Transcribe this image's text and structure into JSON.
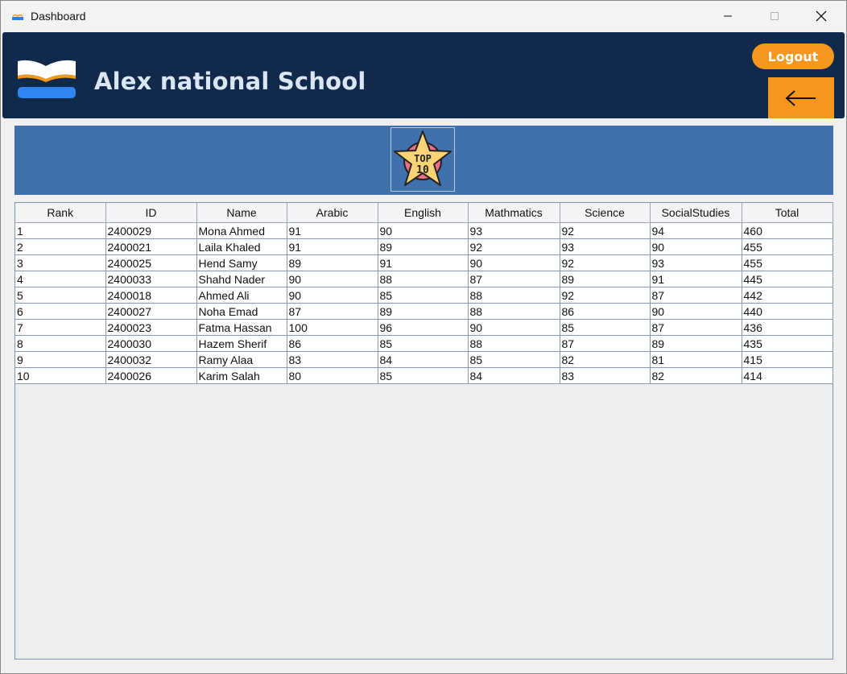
{
  "window": {
    "title": "Dashboard"
  },
  "header": {
    "school_name": "Alex national School",
    "logout_label": "Logout"
  },
  "banner": {
    "badge_line1": "TOP",
    "badge_line2": "10"
  },
  "table": {
    "columns": [
      "Rank",
      "ID",
      "Name",
      "Arabic",
      "English",
      "Mathmatics",
      "Science",
      "SocialStudies",
      "Total"
    ],
    "rows": [
      [
        "1",
        "2400029",
        "Mona Ahmed",
        "91",
        "90",
        "93",
        "92",
        "94",
        "460"
      ],
      [
        "2",
        "2400021",
        "Laila Khaled",
        "91",
        "89",
        "92",
        "93",
        "90",
        "455"
      ],
      [
        "3",
        "2400025",
        "Hend Samy",
        "89",
        "91",
        "90",
        "92",
        "93",
        "455"
      ],
      [
        "4",
        "2400033",
        "Shahd Nader",
        "90",
        "88",
        "87",
        "89",
        "91",
        "445"
      ],
      [
        "5",
        "2400018",
        "Ahmed Ali",
        "90",
        "85",
        "88",
        "92",
        "87",
        "442"
      ],
      [
        "6",
        "2400027",
        "Noha Emad",
        "87",
        "89",
        "88",
        "86",
        "90",
        "440"
      ],
      [
        "7",
        "2400023",
        "Fatma Hassan",
        "100",
        "96",
        "90",
        "85",
        "87",
        "436"
      ],
      [
        "8",
        "2400030",
        "Hazem Sherif",
        "86",
        "85",
        "88",
        "87",
        "89",
        "435"
      ],
      [
        "9",
        "2400032",
        "Ramy Alaa",
        "83",
        "84",
        "85",
        "82",
        "81",
        "415"
      ],
      [
        "10",
        "2400026",
        "Karim Salah",
        "80",
        "85",
        "84",
        "83",
        "82",
        "414"
      ]
    ]
  },
  "colors": {
    "header_bg": "#112a4b",
    "accent_orange": "#f5961d",
    "banner_bg": "#4171ad",
    "title_text": "#dbe6f5"
  },
  "icons": {
    "app": "app-icon",
    "minimize": "minimize-icon",
    "maximize": "maximize-icon",
    "close": "close-icon",
    "logo": "open-book-icon",
    "back": "back-arrow-icon",
    "badge": "top-10-star-icon"
  }
}
